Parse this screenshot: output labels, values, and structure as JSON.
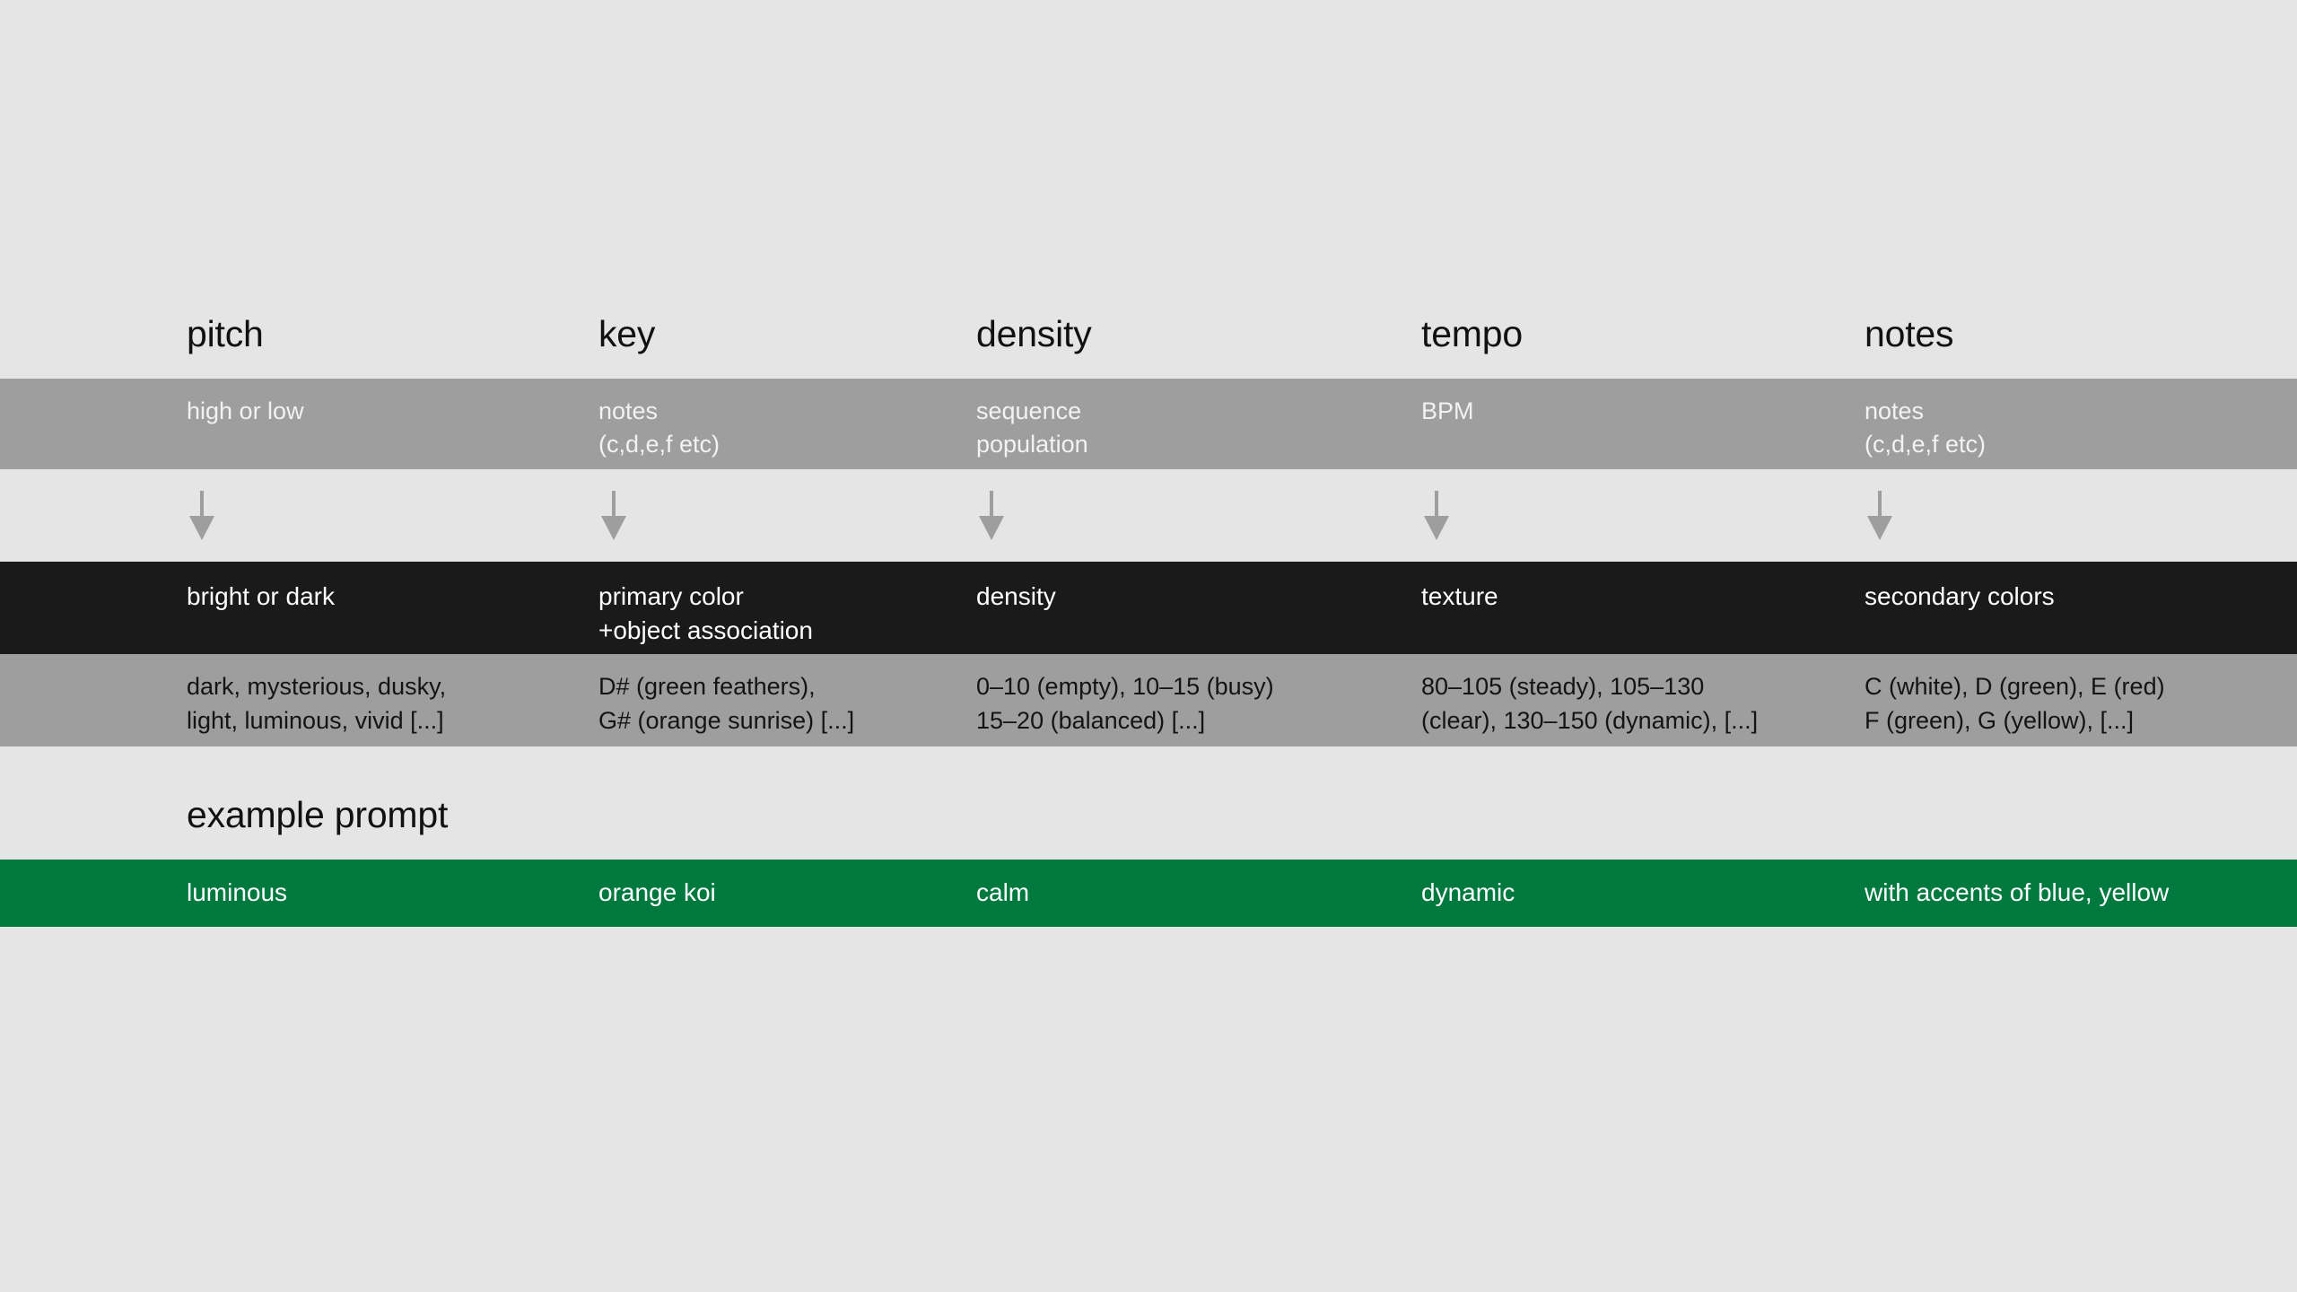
{
  "palette": {
    "background": "#e5e5e5",
    "band_gray": "#9e9e9e",
    "band_black": "#1a1a1a",
    "band_green": "#00793f",
    "title_text": "#111111",
    "light_text": "#ffffff",
    "arrow": "#9e9e9e"
  },
  "columns": [
    {
      "title": "pitch",
      "source": "high or low",
      "mapped": "bright or dark",
      "examples": "dark, mysterious, dusky,\nlight, luminous, vivid [...]",
      "prompt": "luminous"
    },
    {
      "title": "key",
      "source": "notes\n(c,d,e,f etc)",
      "mapped": "primary color\n+object association",
      "examples": "D# (green feathers),\nG# (orange sunrise) [...]",
      "prompt": "orange koi"
    },
    {
      "title": "density",
      "source": "sequence\npopulation",
      "mapped": "density",
      "examples": "0–10 (empty), 10–15 (busy)\n15–20 (balanced) [...]",
      "prompt": "calm"
    },
    {
      "title": "tempo",
      "source": "BPM",
      "mapped": "texture",
      "examples": "80–105 (steady), 105–130\n(clear), 130–150 (dynamic), [...]",
      "prompt": "dynamic"
    },
    {
      "title": "notes",
      "source": "notes\n(c,d,e,f etc)",
      "mapped": "secondary colors",
      "examples": "C (white), D (green), E (red)\nF (green), G (yellow), [...]",
      "prompt": "with accents of blue, yellow"
    }
  ],
  "example_prompt_label": "example prompt",
  "arrow_icon": "arrow-down-icon"
}
